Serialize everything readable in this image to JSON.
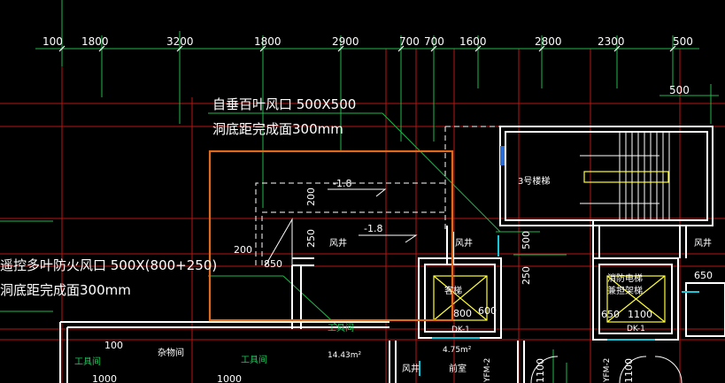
{
  "dimension_row": [
    "100",
    "1800",
    "3200",
    "1800",
    "2900",
    "700",
    "700",
    "1600",
    "2800",
    "2300",
    "500"
  ],
  "dim_500_upper_right": "500",
  "annotation_top": {
    "line1": "自垂百叶风口 500X500",
    "line2": "洞底距完成面300mm"
  },
  "annotation_left": {
    "line1": "遥控多叶防火风口 500X(800+250)",
    "line2": "洞底距完成面300mm"
  },
  "level_markers": [
    "-1.8",
    "-1.8"
  ],
  "dims_shaft": {
    "d200_v": "200",
    "d250_v": "250",
    "d200_h": "200",
    "d850": "850"
  },
  "room_labels": {
    "shaft_main": "风井",
    "shaft_right": "风井",
    "shaft_far_right": "风井",
    "stair_3": "3号楼梯",
    "elevator_1": "客梯",
    "elevator_2": "消防电梯",
    "elevator_2b": "兼担架梯",
    "tool_room_1": "工具间",
    "sundries": "杂物间",
    "tool_room_2": "工具间",
    "tool_room_3": "工具间",
    "area_value": "14.43m²",
    "front_room": "前室",
    "area_small": "4.75m²",
    "shaft_bottom": "风井",
    "dk1_a": "DK-1",
    "dk1_b": "DK-1",
    "yfm2_a": "YFM-2",
    "yfm2_b": "YFM-2"
  },
  "dims_misc": {
    "d500_r": "500",
    "d250_r": "250",
    "d600": "600",
    "d800": "800",
    "d650": "650",
    "d1100": "1100",
    "d650b": "650",
    "d100": "100",
    "d1000a": "1000",
    "d1000b": "1000",
    "d1100a": "1100",
    "d1100b": "1100"
  },
  "colors": {
    "background": "#000000",
    "wall": "#ffffff",
    "green": "#22c55e",
    "red": "#cc1111",
    "yellow": "#ffff33",
    "orange_highlight": "#e06a1b",
    "cyan": "#18c8d8"
  }
}
